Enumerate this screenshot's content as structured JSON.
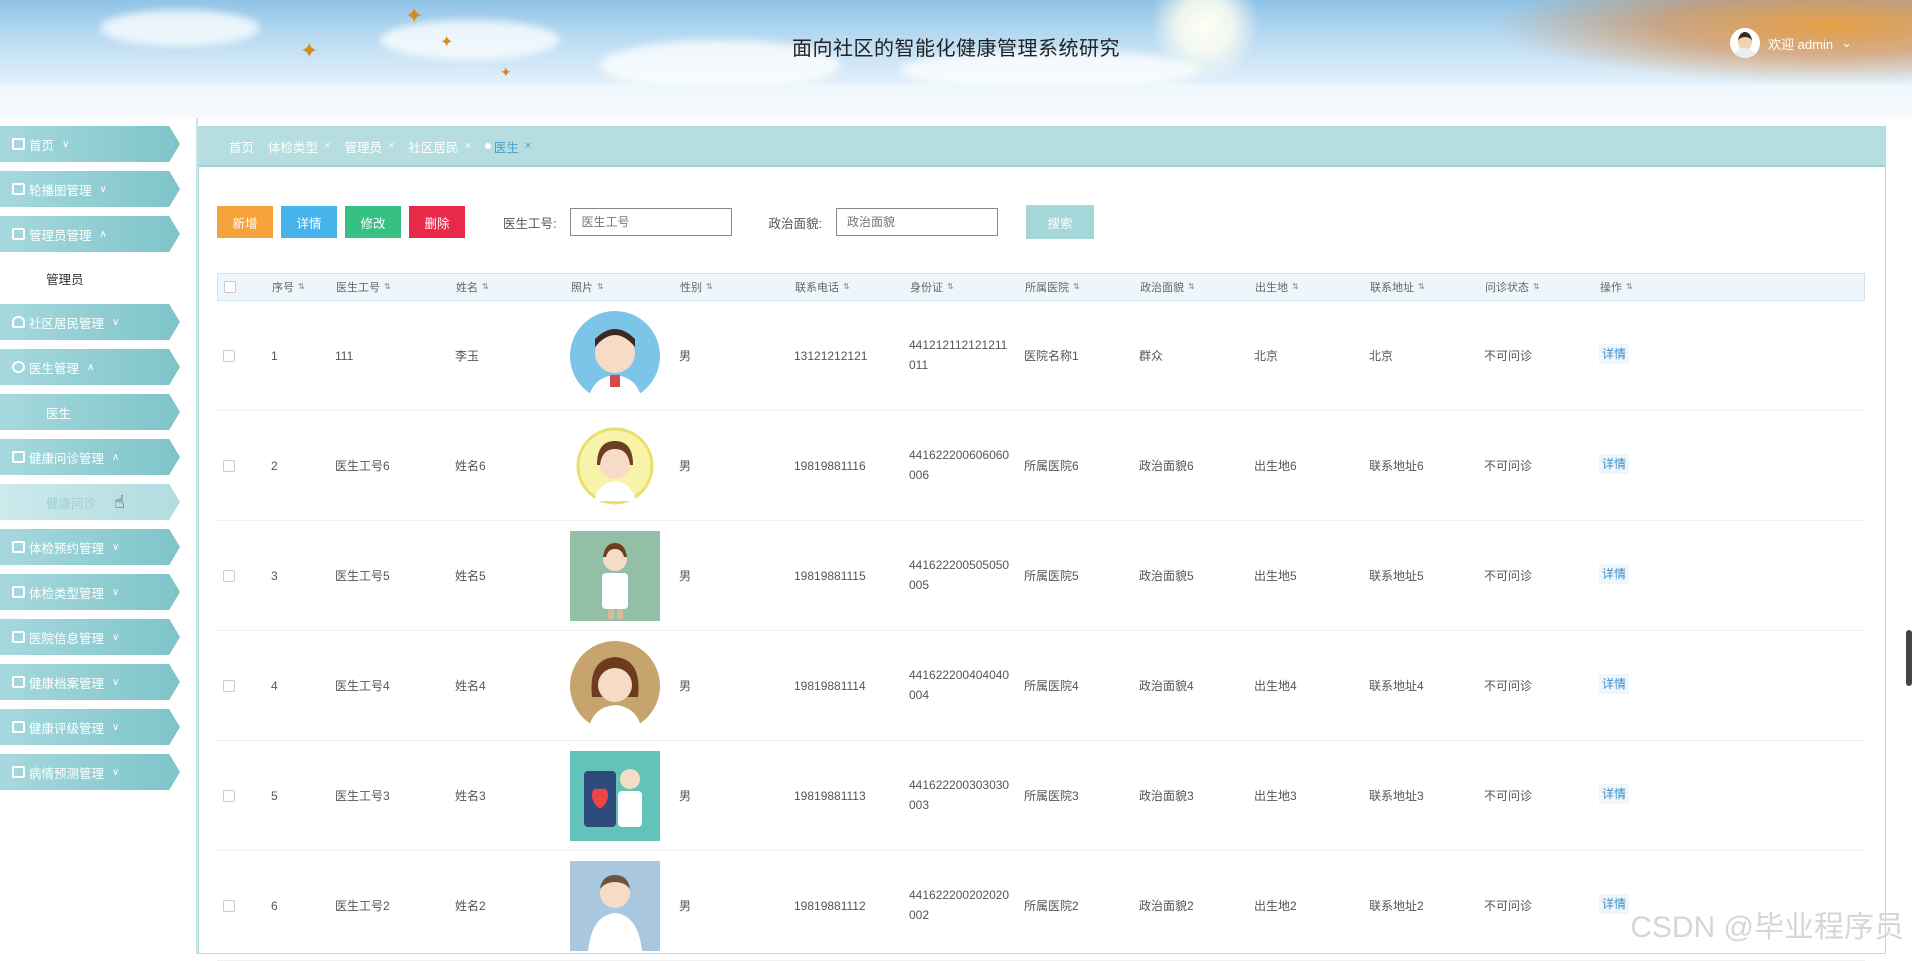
{
  "header": {
    "title": "面向社区的智能化健康管理系统研究",
    "user_label": "欢迎 admin",
    "chevron": "⌄"
  },
  "sidebar": {
    "items": [
      {
        "label": "首页",
        "icon": "home-icon",
        "expanded": false
      },
      {
        "label": "轮播图管理",
        "icon": "grid-icon",
        "expanded": false
      },
      {
        "label": "管理员管理",
        "icon": "grid-icon",
        "expanded": true,
        "children": [
          "管理员"
        ]
      },
      {
        "label": "社区居民管理",
        "icon": "resident-icon",
        "expanded": false
      },
      {
        "label": "医生管理",
        "icon": "person-icon",
        "expanded": true,
        "children": [
          "医生"
        ]
      },
      {
        "label": "健康问诊管理",
        "icon": "consult-icon",
        "expanded": true,
        "children": [
          "健康问诊"
        ]
      },
      {
        "label": "体检预约管理",
        "icon": "calendar-icon",
        "expanded": false
      },
      {
        "label": "体检类型管理",
        "icon": "list-icon",
        "expanded": false
      },
      {
        "label": "医院信息管理",
        "icon": "grid-icon",
        "expanded": false
      },
      {
        "label": "健康档案管理",
        "icon": "file-icon",
        "expanded": false
      },
      {
        "label": "健康评级管理",
        "icon": "card-icon",
        "expanded": false
      },
      {
        "label": "病情预测管理",
        "icon": "image-icon",
        "expanded": false
      }
    ]
  },
  "tabs": [
    {
      "label": "首页",
      "closable": false,
      "active": false
    },
    {
      "label": "体检类型",
      "closable": true,
      "active": false
    },
    {
      "label": "管理员",
      "closable": true,
      "active": false
    },
    {
      "label": "社区居民",
      "closable": true,
      "active": false
    },
    {
      "label": "医生",
      "closable": true,
      "active": true
    }
  ],
  "toolbar": {
    "add_label": "新增",
    "detail_label": "详情",
    "edit_label": "修改",
    "delete_label": "删除",
    "field1_label": "医生工号:",
    "field1_placeholder": "医生工号",
    "field2_label": "政治面貌:",
    "field2_placeholder": "政治面貌",
    "search_label": "搜索",
    "colors": {
      "add": "#f5a23a",
      "detail": "#46b3ea",
      "edit": "#36c081",
      "delete": "#e8294a"
    }
  },
  "table": {
    "columns": [
      "序号",
      "医生工号",
      "姓名",
      "照片",
      "性别",
      "联系电话",
      "身份证",
      "所属医院",
      "政治面貌",
      "出生地",
      "联系地址",
      "问诊状态",
      "操作"
    ],
    "rows": [
      {
        "no": "1",
        "id": "111",
        "name": "李玉",
        "photo": "doctor-round-blue",
        "gender": "男",
        "phone": "13121212121",
        "idcard1": "441212112121211",
        "idcard2": "011",
        "hospital": "医院名称1",
        "politics": "群众",
        "birthplace": "北京",
        "address": "北京",
        "status": "不可问诊",
        "action": "详情"
      },
      {
        "no": "2",
        "id": "医生工号6",
        "name": "姓名6",
        "photo": "doctor-round-yellow",
        "gender": "男",
        "phone": "19819881116",
        "idcard1": "441622200606060",
        "idcard2": "006",
        "hospital": "所属医院6",
        "politics": "政治面貌6",
        "birthplace": "出生地6",
        "address": "联系地址6",
        "status": "不可问诊",
        "action": "详情"
      },
      {
        "no": "3",
        "id": "医生工号5",
        "name": "姓名5",
        "photo": "doctor-square-green",
        "gender": "男",
        "phone": "19819881115",
        "idcard1": "441622200505050",
        "idcard2": "005",
        "hospital": "所属医院5",
        "politics": "政治面貌5",
        "birthplace": "出生地5",
        "address": "联系地址5",
        "status": "不可问诊",
        "action": "详情"
      },
      {
        "no": "4",
        "id": "医生工号4",
        "name": "姓名4",
        "photo": "doctor-round-tan",
        "gender": "男",
        "phone": "19819881114",
        "idcard1": "441622200404040",
        "idcard2": "004",
        "hospital": "所属医院4",
        "politics": "政治面貌4",
        "birthplace": "出生地4",
        "address": "联系地址4",
        "status": "不可问诊",
        "action": "详情"
      },
      {
        "no": "5",
        "id": "医生工号3",
        "name": "姓名3",
        "photo": "doctor-square-teal",
        "gender": "男",
        "phone": "19819881113",
        "idcard1": "441622200303030",
        "idcard2": "003",
        "hospital": "所属医院3",
        "politics": "政治面貌3",
        "birthplace": "出生地3",
        "address": "联系地址3",
        "status": "不可问诊",
        "action": "详情"
      },
      {
        "no": "6",
        "id": "医生工号2",
        "name": "姓名2",
        "photo": "doctor-square-blue",
        "gender": "男",
        "phone": "19819881112",
        "idcard1": "441622200202020",
        "idcard2": "002",
        "hospital": "所属医院2",
        "politics": "政治面貌2",
        "birthplace": "出生地2",
        "address": "联系地址2",
        "status": "不可问诊",
        "action": "详情"
      }
    ]
  },
  "watermark": "CSDN @毕业程序员",
  "colors": {
    "accent": "#7ec4c9",
    "tab_bar": "#b6dde0",
    "link": "#3c8ec8"
  }
}
